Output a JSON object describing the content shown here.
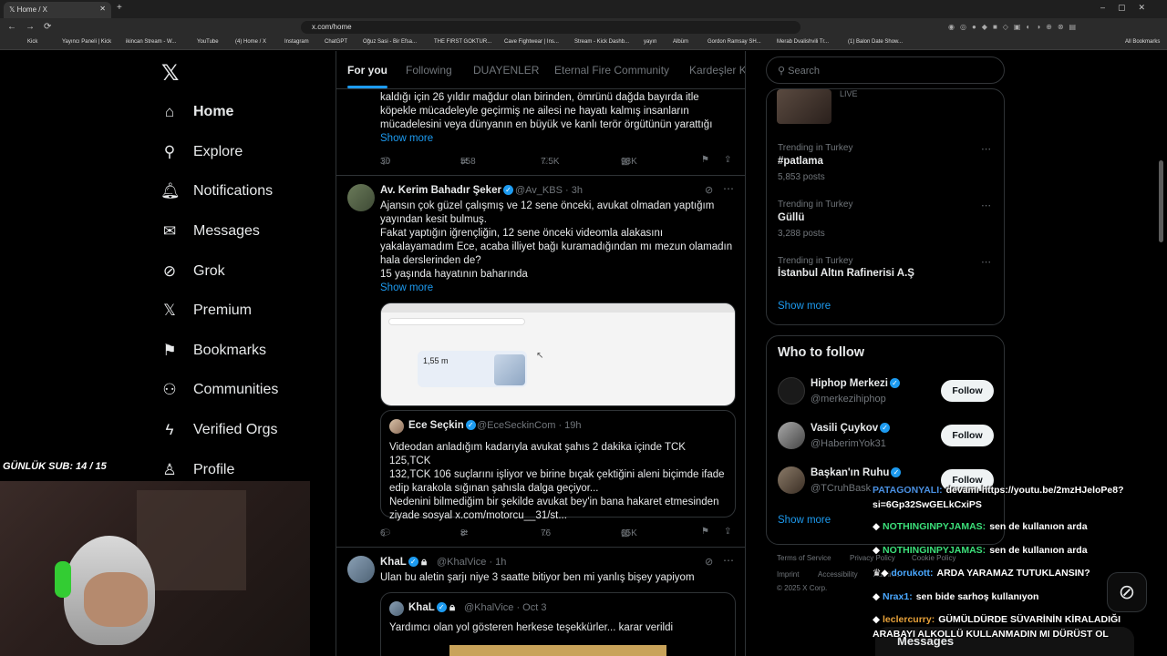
{
  "browser": {
    "tab_title": "Home / X",
    "url": "x.com/home",
    "bookmarks": [
      "Kick",
      "Yayıncı Paneli | Kick",
      "ikincan Stream - W...",
      "YouTube",
      "(4) Home / X",
      "Instagram",
      "ChatGPT",
      "Oğuz Sasi - Bir Efsa...",
      "THE FIRST GOKTUR...",
      "Cave Fightwear | Ins...",
      "Stream - Kick Dashb...",
      "yayın",
      "Albüm",
      "Gordon Ramsay SH...",
      "Merab Dvalishvili Tr...",
      "(1) Balon Date Show...",
      "All Bookmarks"
    ]
  },
  "sidebar": {
    "items": [
      {
        "label": "Home",
        "icon": "home-icon"
      },
      {
        "label": "Explore",
        "icon": "search-icon"
      },
      {
        "label": "Notifications",
        "icon": "bell-icon"
      },
      {
        "label": "Messages",
        "icon": "mail-icon"
      },
      {
        "label": "Grok",
        "icon": "grok-icon"
      },
      {
        "label": "Premium",
        "icon": "x-icon"
      },
      {
        "label": "Bookmarks",
        "icon": "bookmark-icon"
      },
      {
        "label": "Communities",
        "icon": "people-icon"
      },
      {
        "label": "Verified Orgs",
        "icon": "bolt-icon"
      },
      {
        "label": "Profile",
        "icon": "person-icon"
      }
    ]
  },
  "timeline": {
    "tabs": [
      "For you",
      "Following",
      "DUAYENLER",
      "Eternal Fire Community",
      "Kardeşler K"
    ],
    "tweet0": {
      "text_lines": [
        "kaldığı için 26 yıldır mağdur olan birinden, ömrünü dağda bayırda itle",
        "köpekle mücadeleyle geçirmiş ne ailesi ne hayatı kalmış insanların",
        "mücadelesini veya dünyanın en büyük ve kanlı terör örgütünün yarattığı"
      ],
      "show_more": "Show more",
      "replies": "30",
      "reposts": "558",
      "likes": "7.5K",
      "views": "98K"
    },
    "tweet1": {
      "name": "Av. Kerim Bahadır Şeker",
      "handle": "@Av_KBS",
      "time": "· 3h",
      "text_lines": [
        "Ajansın çok güzel çalışmış ve 12 sene önceki, avukat olmadan yaptığım",
        "yayından kesit bulmuş.",
        "Fakat yaptığın iğrençliğin, 12 sene önceki videomla alakasını",
        "yakalayamadım Ece, acaba illiyet bağı kuramadığından mı mezun olamadın",
        "hala derslerinden de?",
        "15 yaşında hayatının baharında"
      ],
      "show_more": "Show more",
      "media_value": "1,55 m",
      "quote": {
        "name": "Ece Seçkin",
        "handle": "@EceSeckinCom",
        "time": "· 19h",
        "text_lines": [
          "Videodan anladığım kadarıyla avukat şahıs 2 dakika içinde TCK 125,TCK",
          "132,TCK 106 suçlarını işliyor ve birine bıçak çektiğini aleni biçimde ifade",
          "edip karakola sığınan şahısla dalga geçiyor...",
          "Nedenini bilmediğim bir şekilde avukat bey'in bana hakaret etmesinden",
          "ziyade sosyal x.com/motorcu__31/st..."
        ]
      },
      "replies": "6",
      "reposts": "8",
      "likes": "76",
      "views": "65K"
    },
    "tweet2": {
      "name": "KhaL",
      "handle": "@KhalVice",
      "time": "· 1h",
      "text": "Ulan bu aletin şarjı niye 3 saatte bitiyor ben mi yanlış bişey yapiyom",
      "quote": {
        "name": "KhaL",
        "handle": "@KhalVice",
        "time": "· Oct 3",
        "text": "Yardımcı olan yol gösteren herkese teşekkürler... karar verildi"
      }
    }
  },
  "right": {
    "search_placeholder": "Search",
    "live_label": "LIVE",
    "trends": [
      {
        "category": "Trending in Turkey",
        "name": "#patlama",
        "count": "5,853 posts"
      },
      {
        "category": "Trending in Turkey",
        "name": "Güllü",
        "count": "3,288 posts"
      },
      {
        "category": "Trending in Turkey",
        "name": "İstanbul Altın Rafinerisi A.Ş",
        "count": ""
      }
    ],
    "show_more": "Show more",
    "who_to_follow": {
      "title": "Who to follow",
      "users": [
        {
          "name": "Hiphop Merkezi",
          "handle": "@merkezihiphop",
          "button": "Follow"
        },
        {
          "name": "Vasili Çuykov",
          "handle": "@HaberimYok31",
          "button": "Follow"
        },
        {
          "name": "Başkan'ın Ruhu",
          "handle": "@TCruhBask",
          "button": "Follow"
        }
      ],
      "show_more": "Show more"
    },
    "footer": [
      "Terms of Service",
      "Privacy Policy",
      "Cookie Policy",
      "Imprint",
      "Accessibility",
      "Ads info",
      "© 2025 X Corp."
    ]
  },
  "overlay": {
    "sub_counter": "GÜNLÜK SUB: 14 / 15",
    "chat": [
      {
        "user": "PATAGONYALI:",
        "text": "devamı https://youtu.be/2mzHJeloPe8?",
        "color": "#4a90e2"
      },
      {
        "user": "",
        "text": "si=6Gp32SwGELkCxiPS",
        "color": "#ffffff"
      },
      {
        "user": "NOTHINGINPYJAMAS:",
        "text": "sen de kullanıon arda",
        "color": "#3ce07a"
      },
      {
        "user": "NOTHINGINPYJAMAS:",
        "text": "sen de kullanıon arda",
        "color": "#3ce07a"
      },
      {
        "user": "dorukott:",
        "text": "ARDA YARAMAZ TUTUKLANSIN?",
        "color": "#4aa8ff"
      },
      {
        "user": "Nrax1:",
        "text": "sen bide sarhoş kullanıyon",
        "color": "#4aa8ff"
      },
      {
        "user": "leclercurry:",
        "text": "GÜMÜLDÜRDE SÜVARİNİN KİRALADIĞI",
        "color": "#e8a23a"
      },
      {
        "user": "",
        "text": "ARABAYI ALKOLLÜ KULLANMADIN MI DÜRÜST OL",
        "color": "#ffffff"
      }
    ],
    "messages_label": "Messages"
  }
}
